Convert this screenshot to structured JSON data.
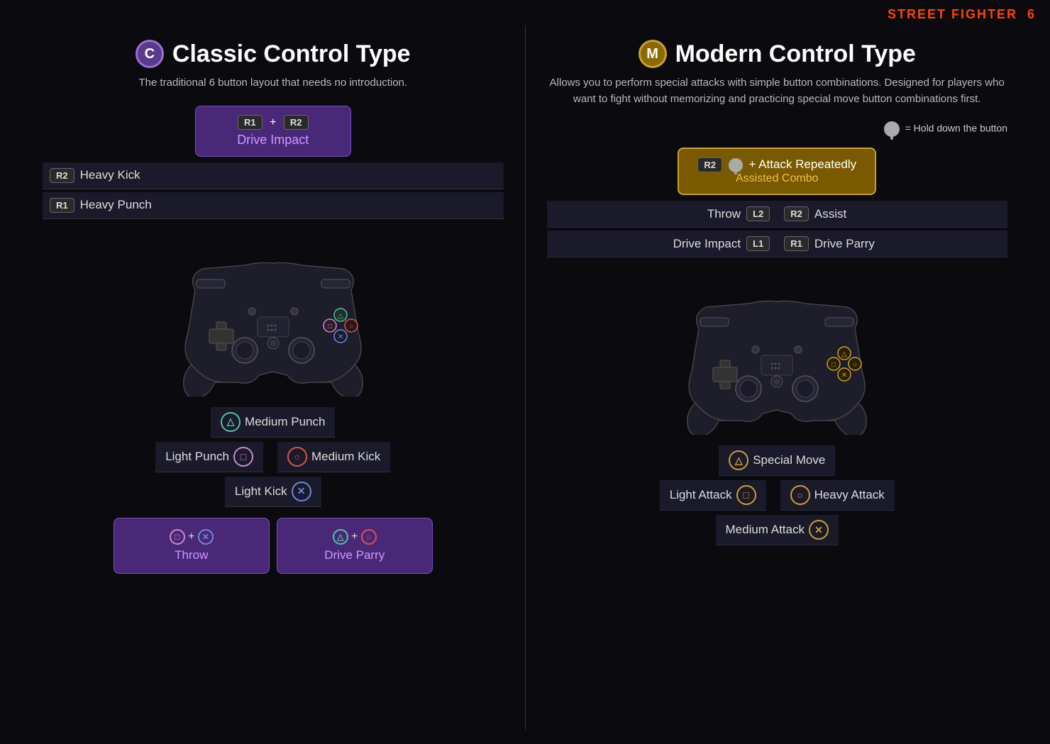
{
  "brand": {
    "name": "STREET FIGHTER",
    "icon": "6"
  },
  "classic": {
    "badge": "C",
    "title": "Classic Control Type",
    "subtitle": "The traditional 6 button layout that needs no introduction.",
    "top_combo": {
      "keys": "R1 + R2",
      "label": "Drive Impact"
    },
    "shoulder_rows": [
      {
        "btn": "R2",
        "label": "Heavy Kick"
      },
      {
        "btn": "R1",
        "label": "Heavy Punch"
      }
    ],
    "face_buttons": {
      "triangle": {
        "symbol": "△",
        "label": "Medium Punch"
      },
      "square": {
        "symbol": "□",
        "label": "Light Punch"
      },
      "circle": {
        "symbol": "○",
        "label": "Medium Kick"
      },
      "cross": {
        "symbol": "✕",
        "label": "Light Kick"
      }
    },
    "bottom_combos": [
      {
        "keys": "□ + ✕",
        "label": "Throw"
      },
      {
        "keys": "△ + ○",
        "label": "Drive Parry"
      }
    ]
  },
  "modern": {
    "badge": "M",
    "title": "Modern Control Type",
    "subtitle": "Allows you to perform special attacks with simple button combinations. Designed for players who want to fight without memorizing and practicing special move button combinations first.",
    "hold_note": "= Hold down the button",
    "top_combo": {
      "line1": "R2 🏆 + Attack Repeatedly",
      "line2": "Assisted Combo"
    },
    "left_rows": [
      {
        "label": "Throw",
        "btn": "L2"
      },
      {
        "label": "Drive Impact",
        "btn": "L1"
      }
    ],
    "right_rows": [
      {
        "btn": "R2",
        "label": "Assist"
      },
      {
        "btn": "R1",
        "label": "Drive Parry"
      }
    ],
    "face_buttons": {
      "triangle": {
        "symbol": "△",
        "label": "Special Move"
      },
      "square": {
        "symbol": "□",
        "label": "Light Attack"
      },
      "circle": {
        "symbol": "○",
        "label": "Heavy Attack"
      },
      "cross": {
        "symbol": "✕",
        "label": "Medium Attack"
      }
    }
  }
}
